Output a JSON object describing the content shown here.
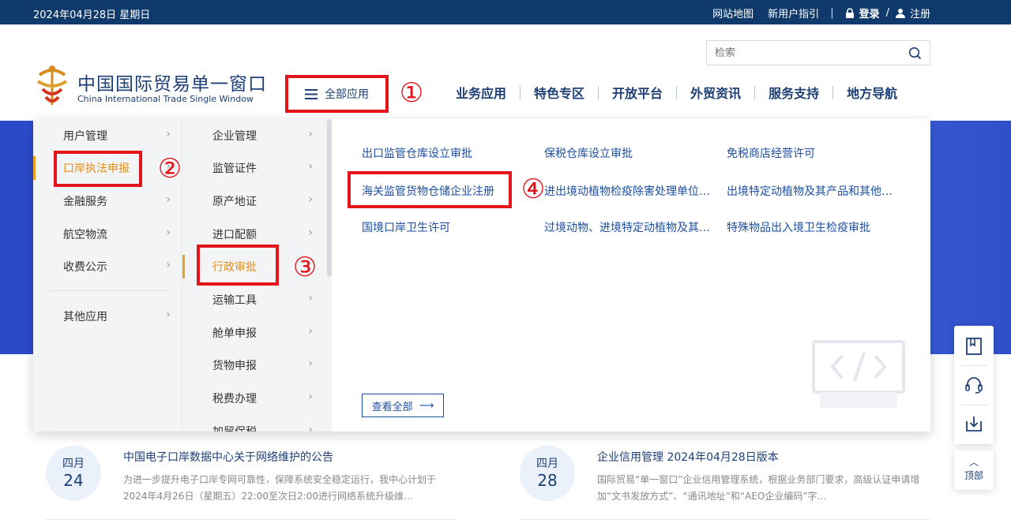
{
  "topbar": {
    "date": "2024年04月28日 星期日",
    "sitemap": "网站地图",
    "guide": "新用户指引",
    "separator": "|",
    "login": "登录",
    "slash": "/",
    "register": "注册"
  },
  "search": {
    "placeholder": "检索"
  },
  "logo": {
    "cn": "中国国际贸易单一窗口",
    "en": "China International Trade Single Window"
  },
  "all_apps": {
    "label": "全部应用",
    "annotation": "①"
  },
  "main_nav": [
    "业务应用",
    "特色专区",
    "开放平台",
    "外贸资讯",
    "服务支持",
    "地方导航"
  ],
  "menu_col1": {
    "items": [
      "用户管理",
      "口岸执法申报",
      "金融服务",
      "航空物流",
      "收费公示",
      "其他应用"
    ],
    "active_index": 1,
    "annotation": "②"
  },
  "menu_col2": {
    "items": [
      "企业管理",
      "监管证件",
      "原产地证",
      "进口配额",
      "行政审批",
      "运输工具",
      "舱单申报",
      "货物申报",
      "税费办理",
      "加贸保税"
    ],
    "active_index": 4,
    "annotation": "③"
  },
  "menu_col3": {
    "links": [
      "出口监管仓库设立审批",
      "保税仓库设立审批",
      "免税商店经营许可",
      "海关监管货物仓储企业注册",
      "进出境动植物检疫除害处理单位…",
      "出境特定动植物及其产品和其他…",
      "国境口岸卫生许可",
      "过境动物、进境特定动植物及其…",
      "特殊物品出入境卫生检疫审批"
    ],
    "annotation": "④",
    "view_all": "查看全部",
    "view_all_arrow": "⟶"
  },
  "float_toolbar": {
    "top_label": "顶部",
    "top_arrow": "︿"
  },
  "news": [
    {
      "month": "四月",
      "day": "24",
      "title": "中国电子口岸数据中心关于网络维护的公告",
      "desc": "为进一步提升电子口岸专网可靠性，保障系统安全稳定运行，我中心计划于2024年4月26日（星期五）22:00至次日2:00进行网络系统升级维…"
    },
    {
      "month": "四月",
      "day": "28",
      "title": "企业信用管理 2024年04月28日版本",
      "desc": "国际贸易“单一窗口”企业信用管理系统，根据业务部门要求，高级认证申请增加“文书发放方式”、“通讯地址”和“AEO企业编码”字…"
    }
  ],
  "colors": {
    "topbar_bg": "#0f3a6b",
    "brand_blue": "#1d3f76",
    "link_blue": "#1d4fa0",
    "annotation_red": "#e3151a",
    "active_orange": "#e58e14",
    "banner_blue": "#3f5fe0"
  }
}
